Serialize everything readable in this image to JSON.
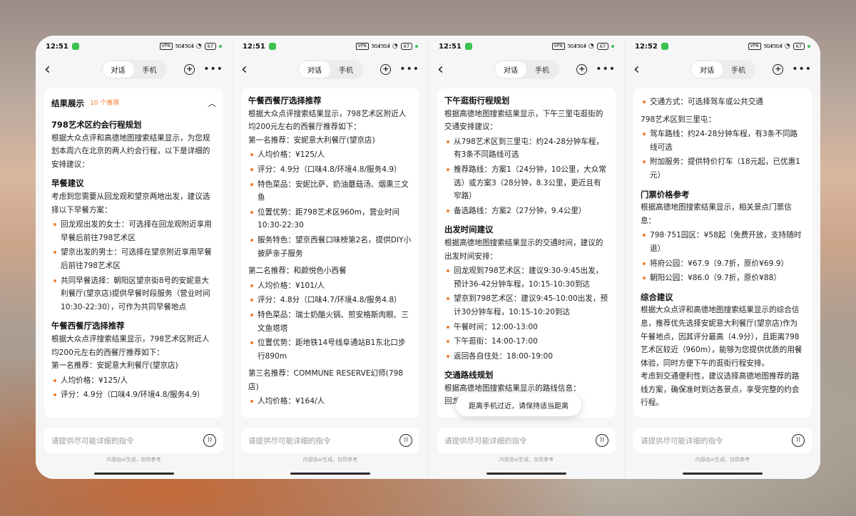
{
  "common": {
    "tab_chat": "对话",
    "tab_phone": "手机",
    "input_placeholder": "请提供尽可能详细的指令",
    "footnote": "内容由ai生成，仅供参考",
    "status_tag": "VPN",
    "status_signal": "5G ıll 5G ıll",
    "status_battery": "67"
  },
  "phones": [
    {
      "time": "12:51",
      "result_title": "结果展示",
      "result_count": "10 个推荐",
      "blocks": [
        {
          "t": "h",
          "text": "798艺术区约会行程规划"
        },
        {
          "t": "p",
          "text": "根据大众点评和高德地图搜索结果显示，为您规划本周六在北京的两人约会行程，以下是详细的安排建议："
        },
        {
          "t": "h",
          "text": "早餐建议"
        },
        {
          "t": "p",
          "text": "考虑到您需要从回龙观和望京两地出发，建议选择以下早餐方案："
        },
        {
          "t": "b",
          "text": "回龙观出发的女士：可选择在回龙观附近享用早餐后前往798艺术区"
        },
        {
          "t": "b",
          "text": "望京出发的男士：可选择在望京附近享用早餐后前往798艺术区"
        },
        {
          "t": "b",
          "text": "共同早餐选择：朝阳区望京街8号的安妮意大利餐厅(望京店)提供早餐时段服务（营业时间10:30-22:30），可作为共同早餐地点"
        },
        {
          "t": "h",
          "text": "午餐西餐厅选择推荐"
        },
        {
          "t": "p",
          "text": "根据大众点评搜索结果显示，798艺术区附近人均200元左右的西餐厅推荐如下："
        },
        {
          "t": "p",
          "text": "第一名推荐：安妮意大利餐厅(望京店)"
        },
        {
          "t": "b",
          "text": "人均价格：¥125/人"
        },
        {
          "t": "b",
          "text": "评分：4.9分（口味4.9/环境4.8/服务4.9）"
        }
      ]
    },
    {
      "time": "12:51",
      "blocks": [
        {
          "t": "h",
          "text": "午餐西餐厅选择推荐"
        },
        {
          "t": "p",
          "text": "根据大众点评搜索结果显示，798艺术区附近人均200元左右的西餐厅推荐如下："
        },
        {
          "t": "p",
          "text": "第一名推荐：安妮意大利餐厅(望京店)"
        },
        {
          "t": "b",
          "text": "人均价格：¥125/人"
        },
        {
          "t": "b",
          "text": "评分：4.9分（口味4.8/环境4.8/服务4.9）"
        },
        {
          "t": "b",
          "text": "特色菜品：安妮比萨、奶油蘑菇汤、烟熏三文鱼"
        },
        {
          "t": "b",
          "text": "位置优势：距798艺术区960m，营业时间10:30-22:30"
        },
        {
          "t": "b",
          "text": "服务特色：望京西餐口味榜第2名，提供DIY小披萨亲子服务"
        },
        {
          "t": "p",
          "text": "第二名推荐：和颜悦色小西餐"
        },
        {
          "t": "b",
          "text": "人均价格：¥101/人"
        },
        {
          "t": "b",
          "text": "评分：4.8分（口味4.7/环境4.8/服务4.8）"
        },
        {
          "t": "b",
          "text": "特色菜品：瑞士奶酪火锅、煎安格斯肉眼、三文鱼塔塔"
        },
        {
          "t": "b",
          "text": "位置优势：距地铁14号线阜通站B1东北口步行890m"
        },
        {
          "t": "p",
          "text": "第三名推荐：COMMUNE RESERVE幻师(798店)"
        },
        {
          "t": "b",
          "text": "人均价格：¥164/人"
        }
      ]
    },
    {
      "time": "12:51",
      "toast": "距离手机过近，请保持适当距离",
      "blocks": [
        {
          "t": "h",
          "text": "下午逛街行程规划"
        },
        {
          "t": "p",
          "text": "根据高德地图搜索结果显示，下午三里屯逛街的交通安排建议："
        },
        {
          "t": "b",
          "text": "从798艺术区到三里屯：约24-28分钟车程，有3条不同路线可选"
        },
        {
          "t": "b",
          "text": "推荐路线：方案1（24分钟，10公里，大众常选）或方案3（28分钟，8.3公里，更近且有窄路）"
        },
        {
          "t": "b",
          "text": "备选路线：方案2（27分钟，9.4公里）"
        },
        {
          "t": "h",
          "text": "出发时间建议"
        },
        {
          "t": "p",
          "text": "根据高德地图搜索结果显示的交通时间，建议的出发时间安排："
        },
        {
          "t": "b",
          "text": "回龙观到798艺术区：建议9:30-9:45出发，预计36-42分钟车程，10:15-10:30到达"
        },
        {
          "t": "b",
          "text": "望京到798艺术区：建议9:45-10:00出发，预计30分钟车程，10:15-10:20到达"
        },
        {
          "t": "b",
          "text": "午餐时间：12:00-13:00"
        },
        {
          "t": "b",
          "text": "下午逛街：14:00-17:00"
        },
        {
          "t": "b",
          "text": "返回各自住处：18:00-19:00"
        },
        {
          "t": "h",
          "text": "交通路线规划"
        },
        {
          "t": "p",
          "text": "根据高德地图搜索结果显示的路线信息："
        },
        {
          "t": "p",
          "text": "回龙观到798艺术区："
        }
      ]
    },
    {
      "time": "12:52",
      "blocks": [
        {
          "t": "b",
          "text": "交通方式：可选择驾车或公共交通"
        },
        {
          "t": "p",
          "text": "798艺术区到三里屯："
        },
        {
          "t": "b",
          "text": "驾车路线：约24-28分钟车程，有3条不同路线可选"
        },
        {
          "t": "b",
          "text": "附加服务：提供特价打车（18元起，已优惠1元）"
        },
        {
          "t": "h",
          "text": "门票价格参考"
        },
        {
          "t": "p",
          "text": "根据高德地图搜索结果显示，相关景点门票信息："
        },
        {
          "t": "b",
          "text": "798·751园区：¥58起（免费开放，支持随时退）"
        },
        {
          "t": "b",
          "text": "将府公园：¥67.9（9.7折，原价¥69.9）"
        },
        {
          "t": "b",
          "text": "朝阳公园：¥86.0（9.7折，原价¥88）"
        },
        {
          "t": "h",
          "text": "综合建议"
        },
        {
          "t": "p",
          "text": "根据大众点评和高德地图搜索结果显示的综合信息，推荐优先选择安妮意大利餐厅(望京店)作为午餐地点，因其评分最高（4.9分），且距离798艺术区较近（960m），能够为您提供优质的用餐体验，同时方便下午的逛街行程安排。"
        },
        {
          "t": "p",
          "text": "考虑到交通便利性，建议选择高德地图推荐的路线方案，确保准时到达各景点，享受完整的约会行程。"
        }
      ]
    }
  ]
}
